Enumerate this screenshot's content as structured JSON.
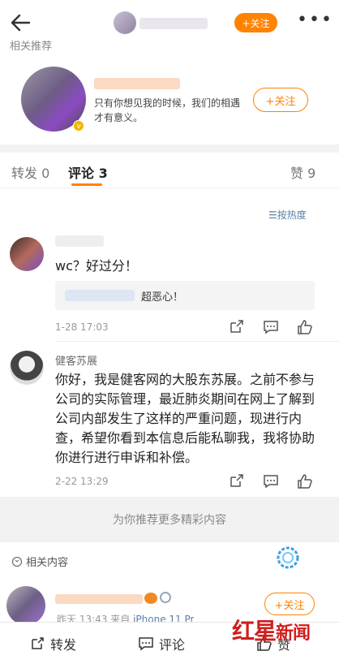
{
  "header": {
    "follow_label": "+关注",
    "more_label": "•••"
  },
  "recommend": {
    "section_title": "相关推荐",
    "description": "只有你想见我的时候，我们的相遇才有意义。",
    "follow_label": "+关注"
  },
  "tabs": [
    {
      "label": "转发 0"
    },
    {
      "label": "评论 3"
    },
    {
      "label": "赞 9"
    }
  ],
  "sort_label": "按热度",
  "comments": [
    {
      "text": "wc？好过分！",
      "reply_text": "超恶心！",
      "time": "1-28 17:03"
    },
    {
      "name": "健客苏展",
      "text": "你好，我是健客网的大股东苏展。之前不参与公司的实际管理，最近肺炎期间在网上了解到公司内部发生了这样的严重问题，现进行内查，希望你看到本信息后能私聊我，我将协助你进行进行申诉和补偿。",
      "time": "2-22 13:29"
    }
  ],
  "more_content": "为你推荐更多精彩内容",
  "related": {
    "title": "相关内容",
    "meta_time": "昨天 13:43",
    "meta_from": "来自",
    "meta_device": "iPhone 11 Pr",
    "follow_label": "+关注"
  },
  "bottom": {
    "repost": "转发",
    "comment": "评论",
    "like": "赞"
  },
  "watermark": {
    "big": "红星",
    "small": "新闻"
  },
  "colors": {
    "accent": "#ff8200",
    "link": "#5b7fa5"
  }
}
